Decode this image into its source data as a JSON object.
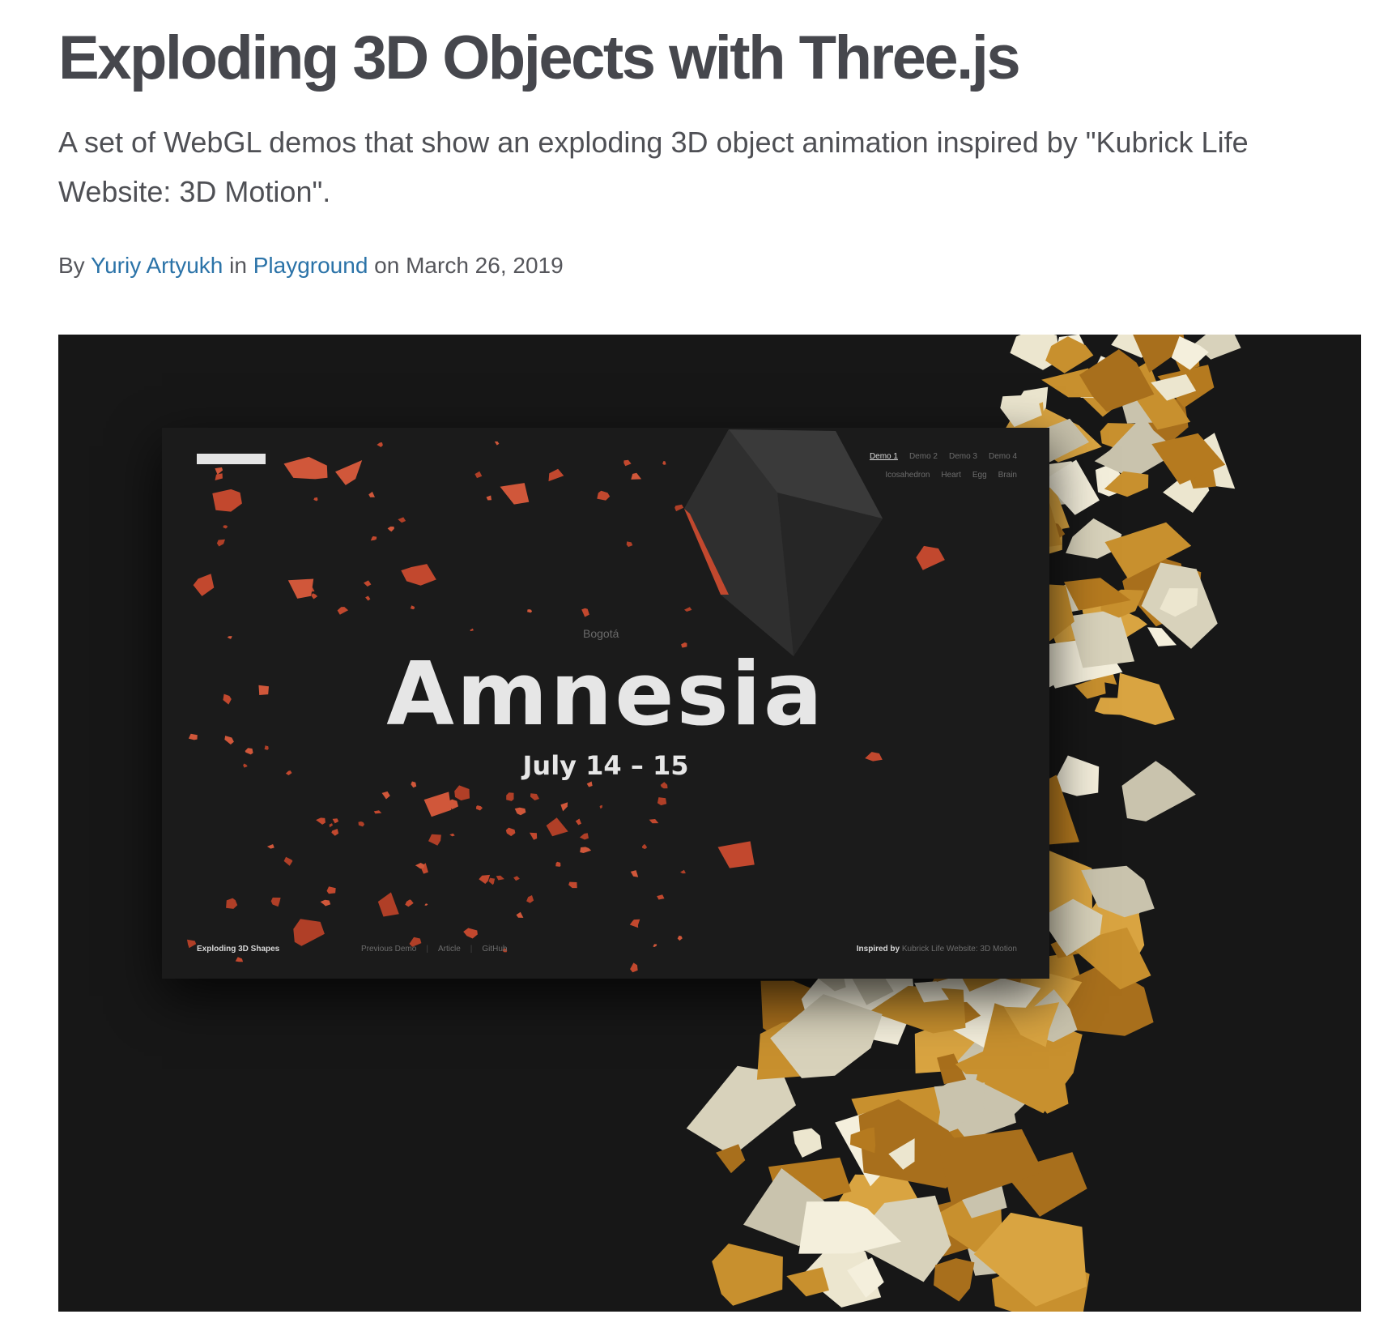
{
  "article": {
    "title": "Exploding 3D Objects with Three.js",
    "subtitle": "A set of WebGL demos that show an exploding 3D object animation inspired by \"Kubrick Life Website: 3D Motion\".",
    "byline": {
      "by": "By",
      "author": "Yuriy Artyukh",
      "in": "in",
      "category": "Playground",
      "on": "on",
      "date": "March 26, 2019"
    }
  },
  "demo": {
    "nav": {
      "demos": [
        "Demo 1",
        "Demo 2",
        "Demo 3",
        "Demo 4"
      ],
      "shapes": [
        "Icosahedron",
        "Heart",
        "Egg",
        "Brain"
      ],
      "active_index": 0
    },
    "city": "Bogotá",
    "headline": "Amnesia",
    "dates": "July 14 – 15",
    "footer": {
      "title": "Exploding 3D Shapes",
      "links": [
        "Previous Demo",
        "Article",
        "GitHub"
      ],
      "inspired_label": "Inspired by",
      "inspired_source": "Kubrick Life Website: 3D Motion"
    }
  },
  "colors": {
    "link": "#2b73a8",
    "fragment_orange": "#c2482e",
    "gold": "#c8902e",
    "ivory": "#ece6cf",
    "hero_bg": "#171717"
  }
}
